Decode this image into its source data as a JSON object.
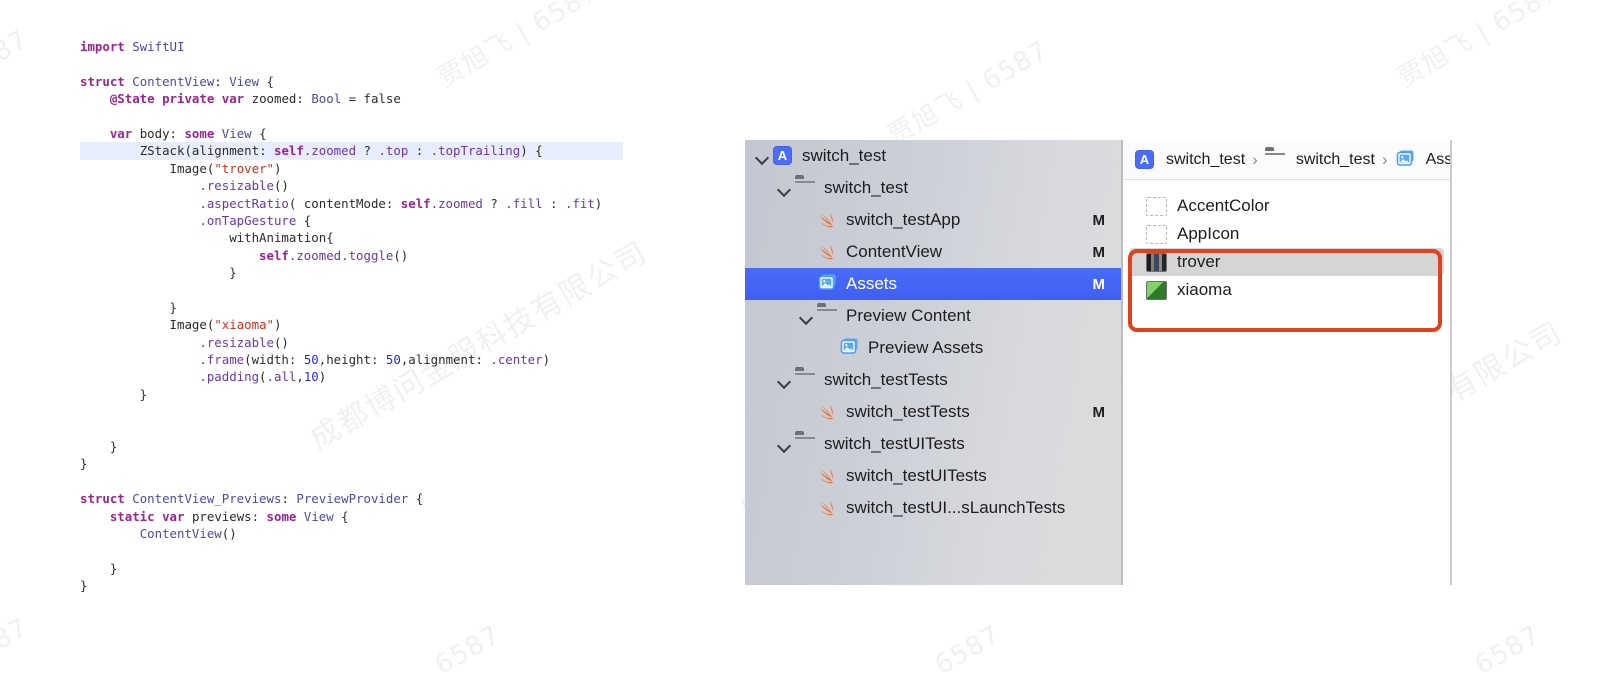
{
  "watermarks": {
    "name_mark": "贾旭飞 | 6587",
    "company_mark": "成都博问金服科技有限公司",
    "short_mark": "6587",
    "partial_mark": "87"
  },
  "code_editor": {
    "language": "Swift",
    "file": "ContentView",
    "highlighted_line_index": 6,
    "lines": [
      "import SwiftUI",
      "",
      "struct ContentView: View {",
      "    @State private var zoomed: Bool = false",
      "",
      "    var body: some View {",
      "        ZStack(alignment: self.zoomed ? .top : .topTrailing) {",
      "            Image(\"trover\")",
      "                .resizable()",
      "                .aspectRatio( contentMode: self.zoomed ? .fill : .fit)",
      "                .onTapGesture {",
      "                    withAnimation{",
      "                        self.zoomed.toggle()",
      "                    }",
      "",
      "            }",
      "            Image(\"xiaoma\")",
      "                .resizable()",
      "                .frame(width: 50,height: 50,alignment: .center)",
      "                .padding(.all,10)",
      "        }",
      "",
      "",
      "    }",
      "}",
      "",
      "struct ContentView_Previews: PreviewProvider {",
      "    static var previews: some View {",
      "        ContentView()",
      "",
      "    }",
      "}"
    ]
  },
  "navigator": {
    "rows": [
      {
        "label": "switch_test",
        "icon": "app-icon",
        "indent": 0,
        "twisty": "open",
        "badge": "",
        "selected": false
      },
      {
        "label": "switch_test",
        "icon": "folder-icon",
        "indent": 1,
        "twisty": "open",
        "badge": "",
        "selected": false
      },
      {
        "label": "switch_testApp",
        "icon": "swift-file-icon",
        "indent": 2,
        "twisty": "none",
        "badge": "M",
        "selected": false
      },
      {
        "label": "ContentView",
        "icon": "swift-file-icon",
        "indent": 2,
        "twisty": "none",
        "badge": "M",
        "selected": false
      },
      {
        "label": "Assets",
        "icon": "assets-catalog-icon",
        "indent": 2,
        "twisty": "none",
        "badge": "M",
        "selected": true
      },
      {
        "label": "Preview Content",
        "icon": "folder-icon",
        "indent": 2,
        "twisty": "open",
        "badge": "",
        "selected": false
      },
      {
        "label": "Preview Assets",
        "icon": "assets-catalog-icon",
        "indent": 3,
        "twisty": "none",
        "badge": "",
        "selected": false
      },
      {
        "label": "switch_testTests",
        "icon": "folder-icon",
        "indent": 1,
        "twisty": "open",
        "badge": "",
        "selected": false
      },
      {
        "label": "switch_testTests",
        "icon": "swift-file-icon",
        "indent": 2,
        "twisty": "none",
        "badge": "M",
        "selected": false
      },
      {
        "label": "switch_testUITests",
        "icon": "folder-icon",
        "indent": 1,
        "twisty": "open",
        "badge": "",
        "selected": false
      },
      {
        "label": "switch_testUITests",
        "icon": "swift-file-icon",
        "indent": 2,
        "twisty": "none",
        "badge": "",
        "selected": false
      },
      {
        "label": "switch_testUI...sLaunchTests",
        "icon": "swift-file-icon",
        "indent": 2,
        "twisty": "none",
        "badge": "",
        "selected": false
      }
    ]
  },
  "asset_editor": {
    "breadcrumb": [
      {
        "label": "switch_test",
        "icon": "app-icon"
      },
      {
        "label": "switch_test",
        "icon": "folder-icon"
      },
      {
        "label": "Ass",
        "icon": "assets-catalog-icon"
      }
    ],
    "separator": "›",
    "assets": [
      {
        "label": "AccentColor",
        "swatch": "placeholder",
        "highlighted": false
      },
      {
        "label": "AppIcon",
        "swatch": "placeholder",
        "highlighted": false
      },
      {
        "label": "trover",
        "swatch": "image-thumbnail-dark",
        "highlighted": true
      },
      {
        "label": "xiaoma",
        "swatch": "image-thumbnail-green",
        "highlighted": false
      }
    ]
  },
  "annotation": {
    "shape": "rounded-rectangle",
    "color": "#e0421c",
    "targets": [
      "trover",
      "xiaoma"
    ]
  },
  "colors": {
    "selection_blue": "#4a6cf7",
    "annotation_red": "#e0421c",
    "navigator_bg": "#cbcfd6",
    "code_highlight": "#e8edfb",
    "swift_keyword": "#9b2393",
    "swift_string": "#d12f1b",
    "swift_number": "#272ad8",
    "swift_type": "#4b4ba3",
    "swift_method": "#6c36a9"
  }
}
